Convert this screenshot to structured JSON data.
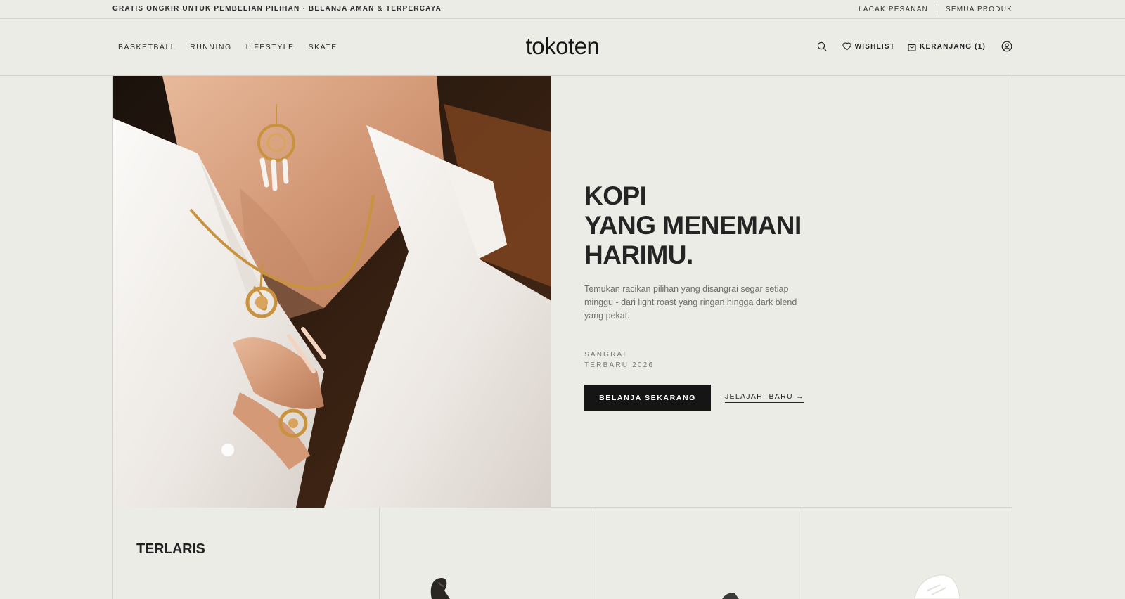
{
  "announcement": {
    "promo": "GRATIS ONGKIR UNTUK PEMBELIAN PILIHAN · BELANJA AMAN & TERPERCAYA",
    "links": [
      "LACAK PESANAN",
      "SEMUA PRODUK"
    ]
  },
  "header": {
    "nav": [
      "BASKETBALL",
      "RUNNING",
      "LIFESTYLE",
      "SKATE"
    ],
    "logo": "tokoten",
    "wishlist": "WISHLIST",
    "cart": "KERANJANG (1)"
  },
  "hero": {
    "title_lines": [
      "KOPI",
      "YANG MENEMANI",
      "HARIMU."
    ],
    "description": "Temukan racikan pilihan yang disangrai segar setiap minggu - dari light roast yang ringan hingga dark blend yang pekat.",
    "meta_lines": [
      "SANGRAI",
      "TERBARU 2026"
    ],
    "primary_cta": "BELANJA SEKARANG",
    "secondary_cta": "JELAJAHI BARU →"
  },
  "bestsellers": {
    "title": "TERLARIS"
  },
  "colors": {
    "background": "#ecece7",
    "text": "#1b1b1b",
    "button": "#151515",
    "border": "#d4d4ce"
  }
}
